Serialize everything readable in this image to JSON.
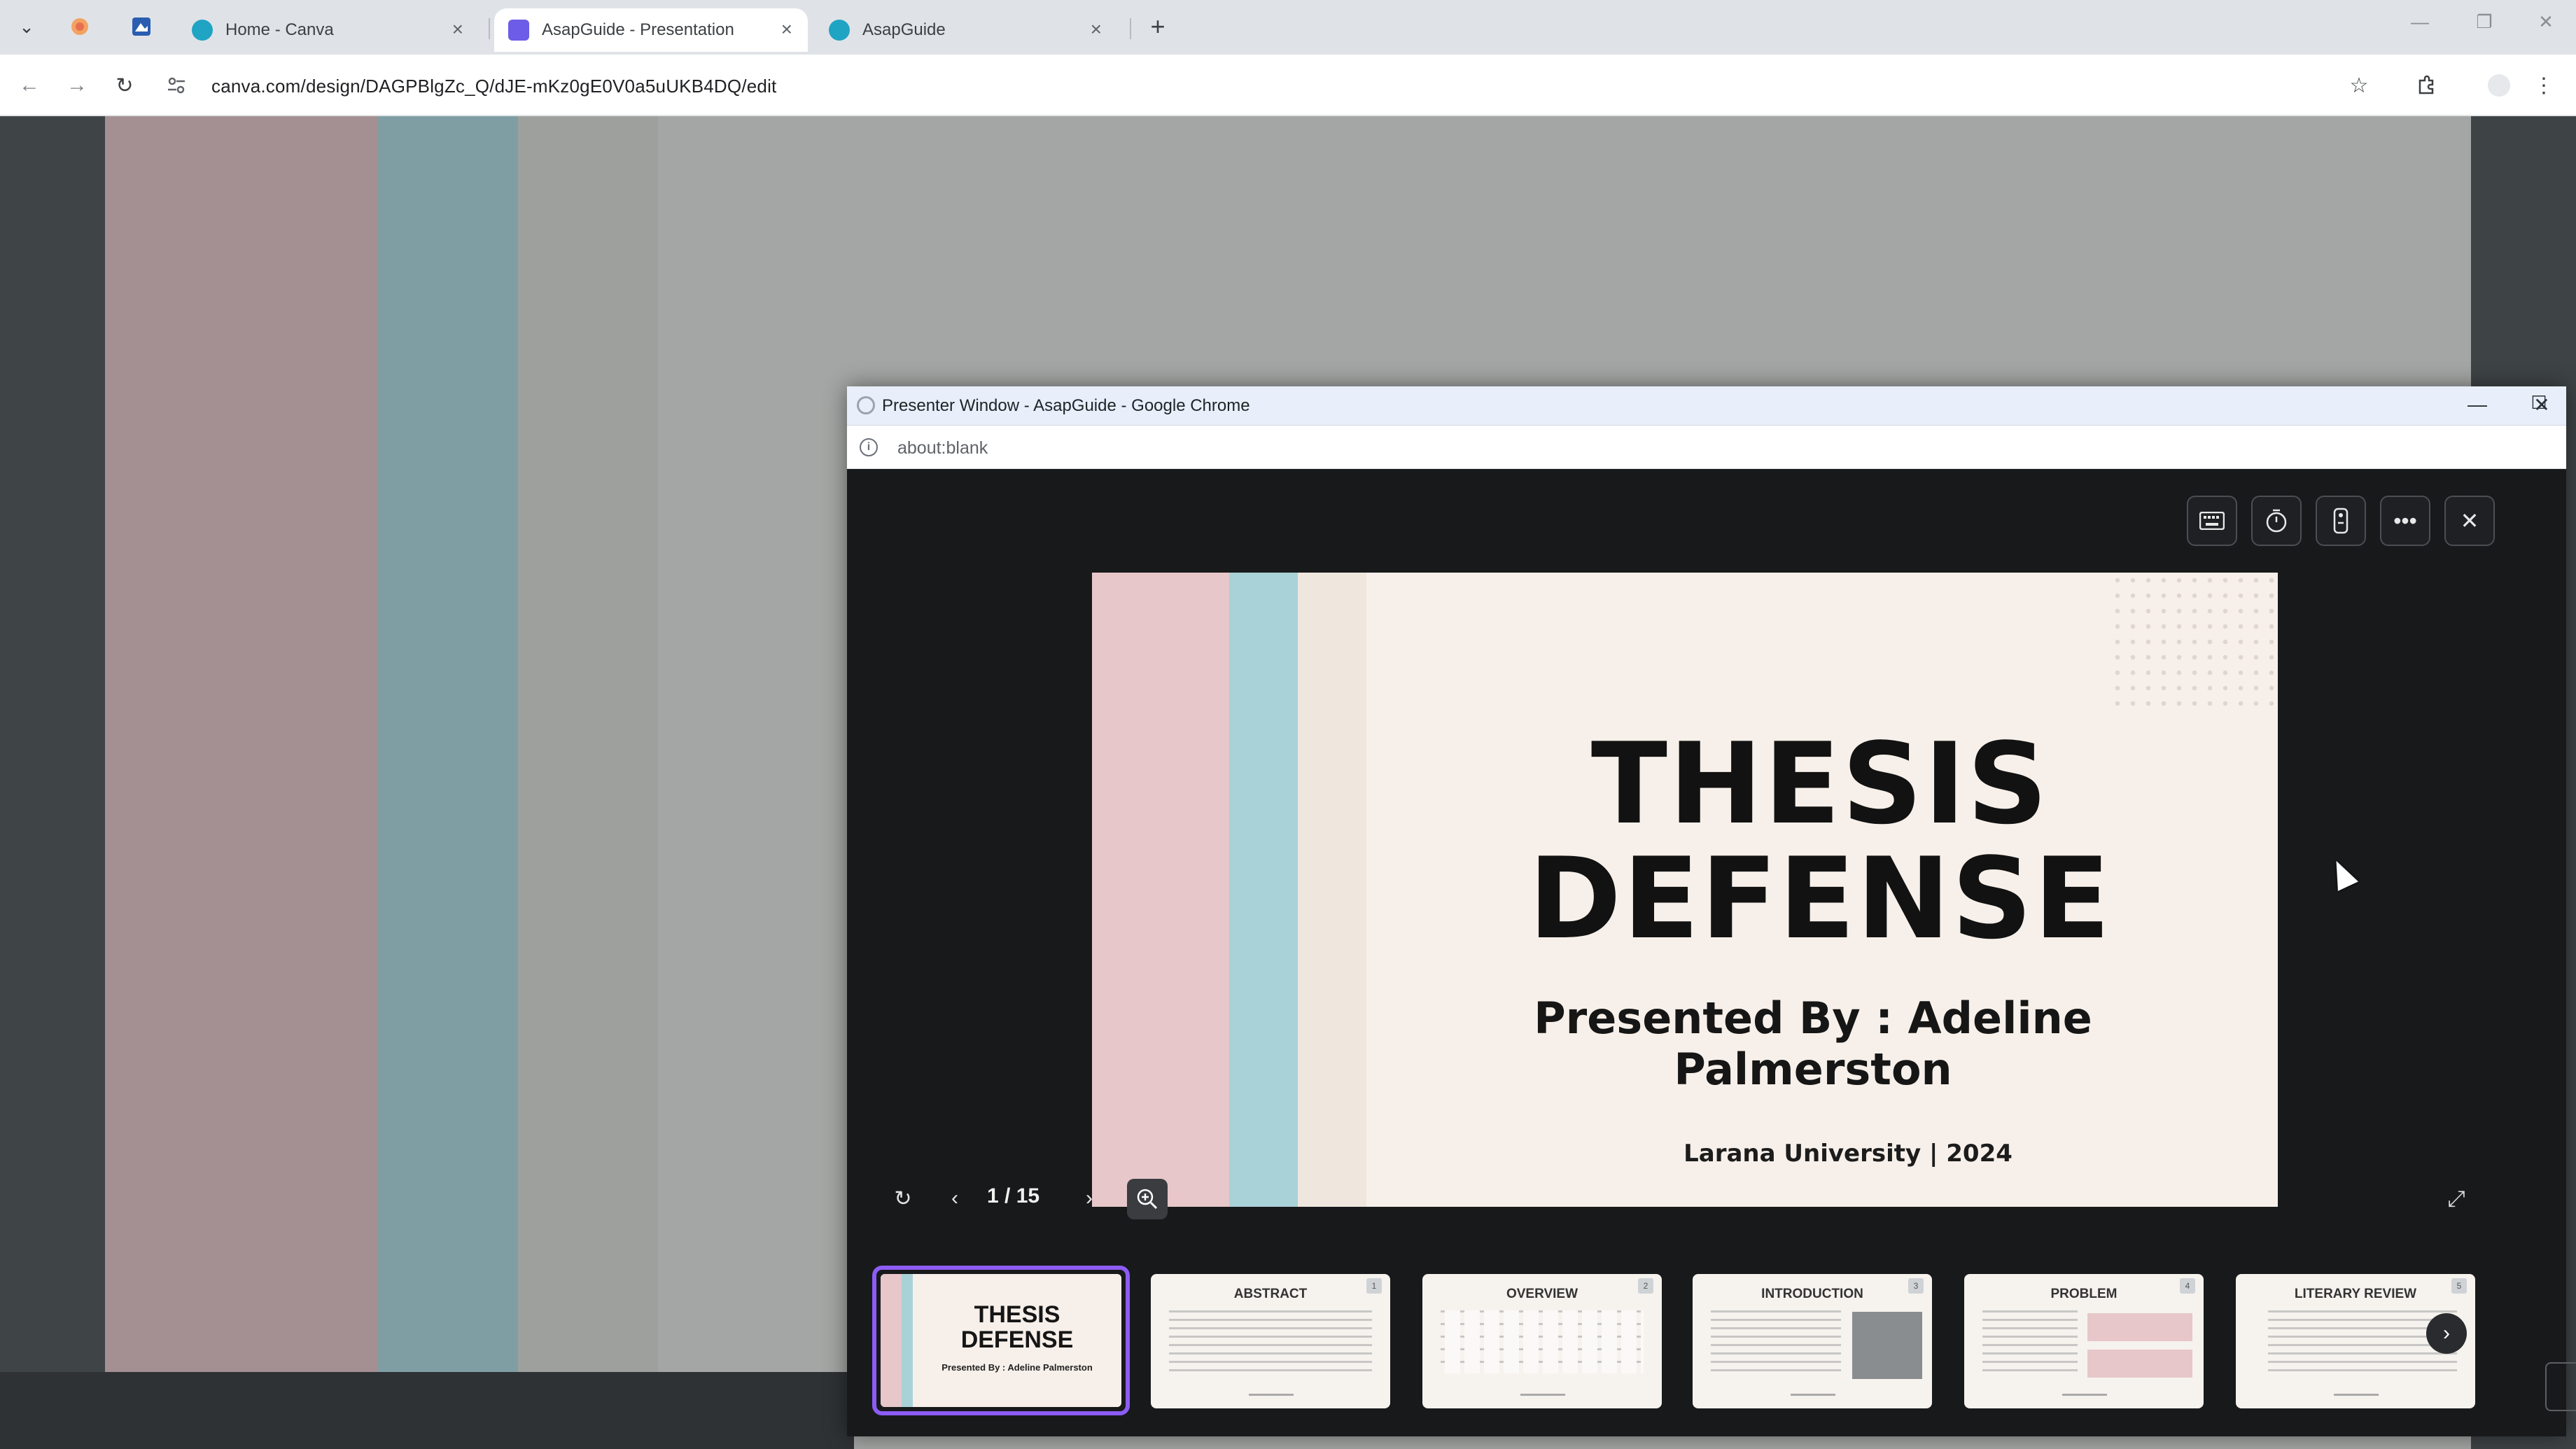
{
  "browser": {
    "tabs": [
      {
        "label": "Home - Canva",
        "active": false
      },
      {
        "label": "AsapGuide - Presentation",
        "active": true
      },
      {
        "label": "AsapGuide",
        "active": false
      }
    ],
    "url": "canva.com/design/DAGPBlgZc_Q/dJE-mKz0gE0V0a5uUKB4DQ/edit"
  },
  "presenter_window": {
    "title": "Presenter Window - AsapGuide - Google Chrome",
    "address": "about:blank",
    "controls": [
      "keyboard-icon",
      "timer-icon",
      "remote-icon",
      "more-icon",
      "close-icon"
    ],
    "slide": {
      "title_line1": "THESIS",
      "title_line2": "DEFENSE",
      "presented_by": "Presented By : Adeline Palmerston",
      "university": "Larana University | 2024"
    },
    "page_indicator": "1 / 15",
    "thumbnails": [
      {
        "title_line1": "THESIS",
        "title_line2": "DEFENSE",
        "subtitle": "Presented By : Adeline Palmerston",
        "number": "",
        "active": true
      },
      {
        "title": "ABSTRACT",
        "number": "1",
        "active": false
      },
      {
        "title": "OVERVIEW",
        "number": "2",
        "active": false
      },
      {
        "title": "INTRODUCTION",
        "number": "3",
        "active": false
      },
      {
        "title": "PROBLEM",
        "number": "4",
        "active": false
      },
      {
        "title": "LITERARY REVIEW",
        "number": "5",
        "active": false
      }
    ]
  },
  "colors": {
    "accent": "#8c5cf5",
    "slide_pink": "#e7c7c9",
    "slide_blue": "#a9d2d8",
    "slide_bg": "#f7f0ea"
  }
}
